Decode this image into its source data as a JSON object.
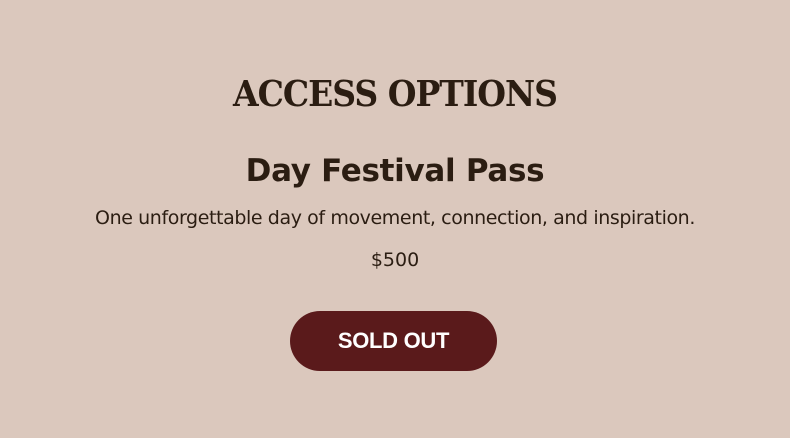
{
  "section": {
    "heading": "ACCESS OPTIONS"
  },
  "card": {
    "title": "Day Festival Pass",
    "description": "One unforgettable day of movement, connection, and inspiration.",
    "price": "$500",
    "button_label": "SOLD OUT"
  },
  "colors": {
    "background": "#dbc8bd",
    "text": "#2b1d12",
    "button": "#5a1a1b",
    "button_text": "#ffffff"
  }
}
